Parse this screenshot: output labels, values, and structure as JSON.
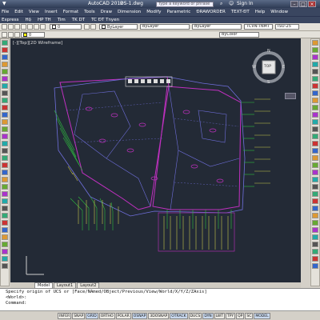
{
  "titlebar": {
    "app_title": "AutoCAD 2012",
    "file_title": "ĐS-1.dwg",
    "search_placeholder": "Type a keyword or phrase",
    "sign_in": "Sign In"
  },
  "menus": [
    "File",
    "Edit",
    "View",
    "Insert",
    "Format",
    "Tools",
    "Draw",
    "Dimension",
    "Modify",
    "Parametric",
    "ĐRAWORDER",
    "TEXT-ĐT",
    "Help",
    "Window"
  ],
  "menus2": [
    "Express",
    "Hộ",
    "HP TH",
    "Tim",
    "TK DT",
    "TC ĐT Tnyen"
  ],
  "toolbar": {
    "layer_value": "0",
    "color_value": "ByLayer",
    "linetype_value": "ByLayer",
    "lineweight_value": "ByLayer",
    "plotstyle_value": "ByColor",
    "dimstyle_value": "ISO-25",
    "textstyle_value": "TCVN-TNMT"
  },
  "viewport": {
    "label": "[-][Top][2D Wireframe]",
    "viewcube_face": "TOP",
    "compass": {
      "n": "N",
      "s": "S",
      "e": "E",
      "w": "W"
    }
  },
  "tabs": [
    "Model",
    "Layout1",
    "Layout2"
  ],
  "command_lines": [
    "Specify origin of UCS or [Face/NAmed/OBject/Previous/View/World/X/Y/Z/ZAxis]",
    "<World>:",
    "Command:"
  ],
  "status_toggles": [
    "INFER",
    "SNAP",
    "GRID",
    "ORTHO",
    "POLAR",
    "OSNAP",
    "3DOSNAP",
    "OTRACK",
    "DUCS",
    "DYN",
    "LWT",
    "TPY",
    "QP",
    "SC",
    "MODEL"
  ],
  "colors": {
    "viewport_bg": "#232a36",
    "boundary": "#c030c0",
    "parcel": "#6f6fdc",
    "annotation": "#c8c84a",
    "leader": "#2fbf3f"
  }
}
